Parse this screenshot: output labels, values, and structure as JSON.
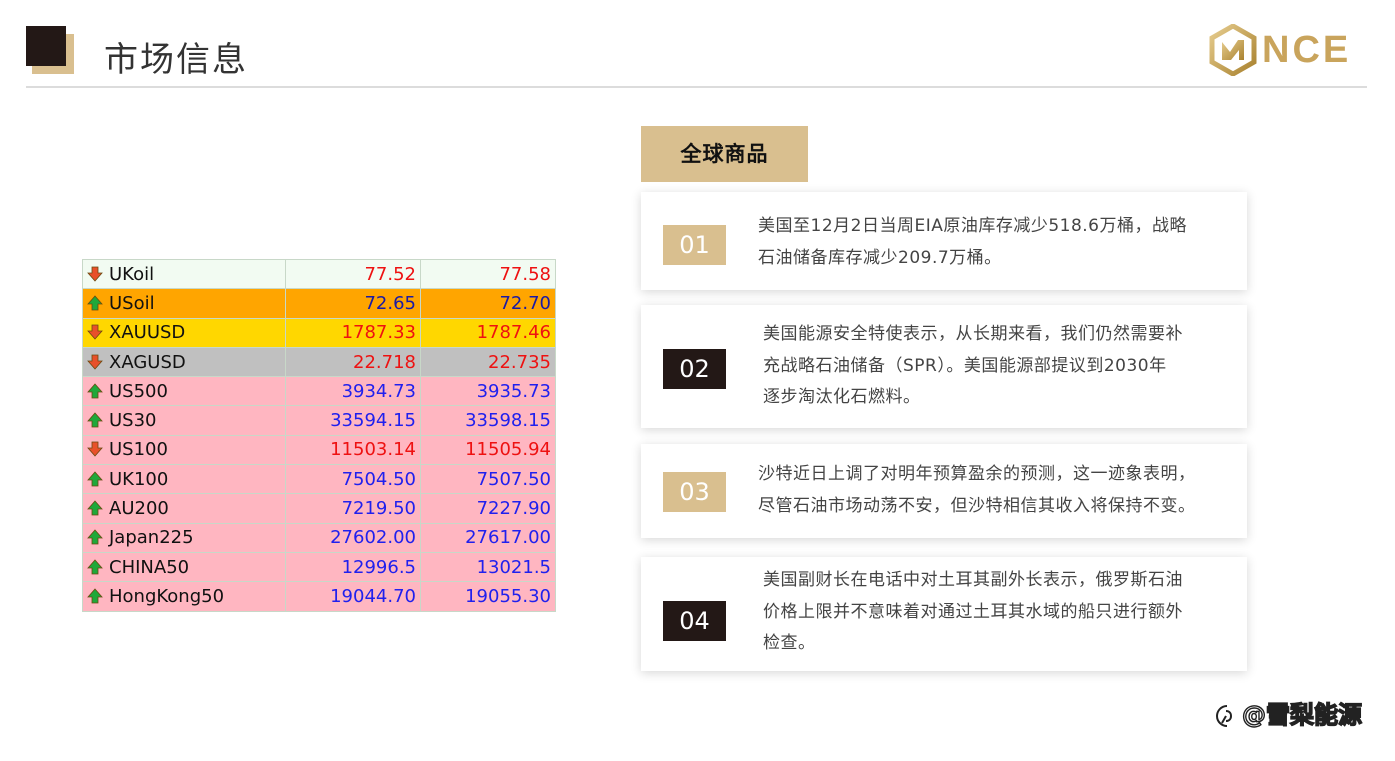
{
  "header": {
    "title": "市场信息",
    "logo_text": "NCE",
    "logo_color": "#c9a45c"
  },
  "quotes": [
    {
      "symbol": "UKoil",
      "direction": "down",
      "bid": "77.52",
      "ask": "77.58",
      "row_bg": "#f2fbf2",
      "num_color": "#ee1111"
    },
    {
      "symbol": "USoil",
      "direction": "up",
      "bid": "72.65",
      "ask": "72.70",
      "row_bg": "#ffa500",
      "num_color": "#1a1aa6"
    },
    {
      "symbol": "XAUUSD",
      "direction": "down",
      "bid": "1787.33",
      "ask": "1787.46",
      "row_bg": "#ffd700",
      "num_color": "#ee1111"
    },
    {
      "symbol": "XAGUSD",
      "direction": "down",
      "bid": "22.718",
      "ask": "22.735",
      "row_bg": "#c0c0c0",
      "num_color": "#ee1111"
    },
    {
      "symbol": "US500",
      "direction": "up",
      "bid": "3934.73",
      "ask": "3935.73",
      "row_bg": "#ffb6c1",
      "num_color": "#2020ee"
    },
    {
      "symbol": "US30",
      "direction": "up",
      "bid": "33594.15",
      "ask": "33598.15",
      "row_bg": "#ffb6c1",
      "num_color": "#2020ee"
    },
    {
      "symbol": "US100",
      "direction": "down",
      "bid": "11503.14",
      "ask": "11505.94",
      "row_bg": "#ffb6c1",
      "num_color": "#ee1111"
    },
    {
      "symbol": "UK100",
      "direction": "up",
      "bid": "7504.50",
      "ask": "7507.50",
      "row_bg": "#ffb6c1",
      "num_color": "#2020ee"
    },
    {
      "symbol": "AU200",
      "direction": "up",
      "bid": "7219.50",
      "ask": "7227.90",
      "row_bg": "#ffb6c1",
      "num_color": "#2020ee"
    },
    {
      "symbol": "Japan225",
      "direction": "up",
      "bid": "27602.00",
      "ask": "27617.00",
      "row_bg": "#ffb6c1",
      "num_color": "#2020ee"
    },
    {
      "symbol": "CHINA50",
      "direction": "up",
      "bid": "12996.5",
      "ask": "13021.5",
      "row_bg": "#ffb6c1",
      "num_color": "#2020ee"
    },
    {
      "symbol": "HongKong50",
      "direction": "up",
      "bid": "19044.70",
      "ask": "19055.30",
      "row_bg": "#ffb6c1",
      "num_color": "#2020ee"
    }
  ],
  "section": {
    "label": "全球商品"
  },
  "news": [
    {
      "num": "01",
      "style": "light",
      "lines": [
        "美国至12月2日当周EIA原油库存减少518.6万桶，战略",
        "石油储备库存减少209.7万桶。"
      ]
    },
    {
      "num": "02",
      "style": "dark",
      "lines": [
        "美国能源安全特使表示，从长期来看，我们仍然需要补",
        "充战略石油储备（SPR）。美国能源部提议到2030年",
        "逐步淘汰化石燃料。"
      ]
    },
    {
      "num": "03",
      "style": "light",
      "lines": [
        "沙特近日上调了对明年预算盈余的预测，这一迹象表明，",
        "尽管石油市场动荡不安，但沙特相信其收入将保持不变。"
      ]
    },
    {
      "num": "04",
      "style": "dark",
      "lines": [
        "美国副财长在电话中对土耳其副外长表示，俄罗斯石油",
        "价格上限并不意味着对通过土耳其水域的船只进行额外",
        "检查。"
      ]
    }
  ],
  "watermark": {
    "text": "@雪梨能源"
  },
  "colors": {
    "gold": "#d9bf8f",
    "dark": "#231816",
    "arrow_up": "#1fa83a",
    "arrow_down": "#e8502a"
  }
}
